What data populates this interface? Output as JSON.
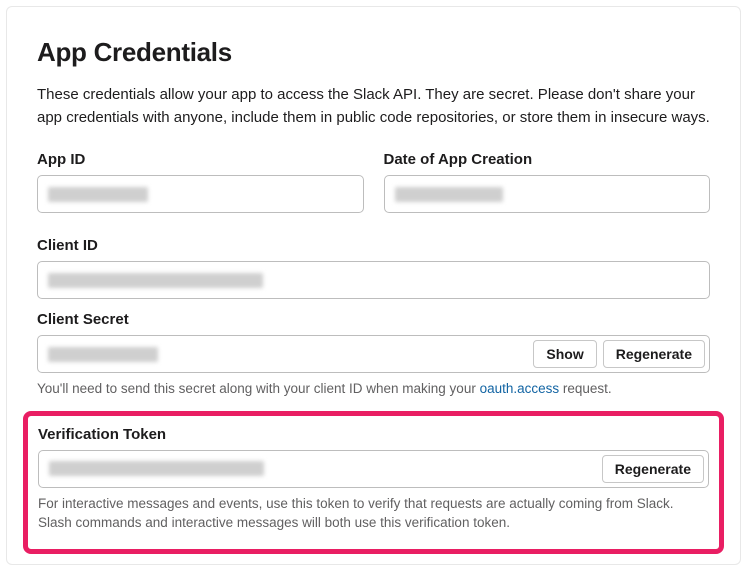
{
  "header": {
    "title": "App Credentials",
    "description": "These credentials allow your app to access the Slack API. They are secret. Please don't share your app credentials with anyone, include them in public code repositories, or store them in insecure ways."
  },
  "fields": {
    "app_id": {
      "label": "App ID",
      "value": ""
    },
    "date_created": {
      "label": "Date of App Creation",
      "value": ""
    },
    "client_id": {
      "label": "Client ID",
      "value": ""
    },
    "client_secret": {
      "label": "Client Secret",
      "value": "",
      "show_label": "Show",
      "regenerate_label": "Regenerate",
      "help_prefix": "You'll need to send this secret along with your client ID when making your ",
      "help_link": "oauth.access",
      "help_suffix": " request."
    },
    "verification_token": {
      "label": "Verification Token",
      "value": "",
      "regenerate_label": "Regenerate",
      "help": "For interactive messages and events, use this token to verify that requests are actually coming from Slack. Slash commands and interactive messages will both use this verification token."
    }
  }
}
